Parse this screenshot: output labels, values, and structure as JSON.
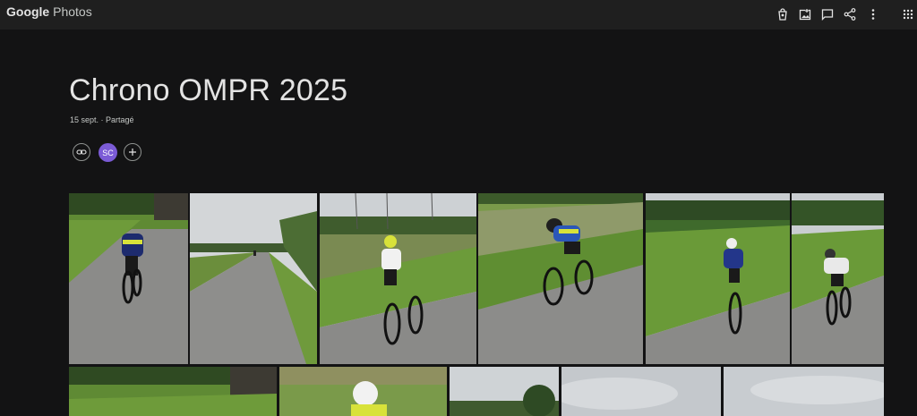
{
  "app": {
    "logo_google": "Google",
    "logo_photos": "Photos"
  },
  "toolbar": {
    "buttons": [
      {
        "name": "order-prints-icon"
      },
      {
        "name": "add-photos-icon"
      },
      {
        "name": "comments-icon"
      },
      {
        "name": "share-icon"
      },
      {
        "name": "more-options-icon"
      },
      {
        "name": "apps-grid-icon"
      }
    ]
  },
  "album": {
    "title": "Chrono OMPR 2025",
    "meta": "15 sept. · Partagé",
    "avatar_initials": "SC",
    "avatar_color": "#7b5bd6"
  },
  "photos_count_visible": 11,
  "colors": {
    "background": "#131314",
    "topbar": "#1f1f1f",
    "grass": "#6f9a3c",
    "road": "#8d8d8b",
    "sky": "#cfd3d6"
  }
}
